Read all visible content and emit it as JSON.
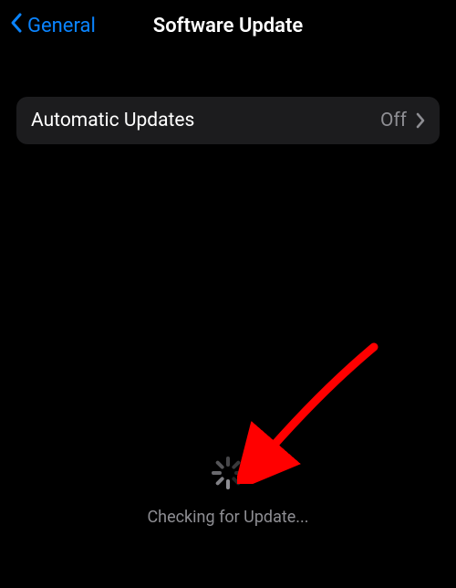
{
  "nav": {
    "back_label": "General",
    "title": "Software Update"
  },
  "rows": {
    "automatic_updates": {
      "label": "Automatic Updates",
      "value": "Off"
    }
  },
  "status": {
    "checking_text": "Checking for Update..."
  },
  "annotation": {
    "arrow_color": "#ff0000"
  }
}
